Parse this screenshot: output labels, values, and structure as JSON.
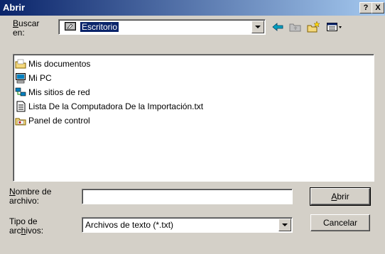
{
  "window": {
    "title": "Abrir",
    "help": "?",
    "close": "X"
  },
  "look_in": {
    "label_accel": "B",
    "label_rest": "uscar",
    "label_line2": "en:",
    "value": "Escritorio"
  },
  "toolbar": {
    "icons": [
      "back-arrow-icon",
      "up-folder-icon",
      "new-folder-icon",
      "view-menu-icon"
    ]
  },
  "files": [
    {
      "name": "Mis documentos",
      "icon": "my-documents-icon"
    },
    {
      "name": "Mi PC",
      "icon": "my-computer-icon"
    },
    {
      "name": "Mis sitios de red",
      "icon": "network-places-icon"
    },
    {
      "name": "Lista De la Computadora De la Importación.txt",
      "icon": "text-file-icon"
    },
    {
      "name": "Panel de control",
      "icon": "control-panel-icon"
    }
  ],
  "filename": {
    "label_accel": "N",
    "label_rest": "ombre de",
    "label_line2": "archivo:",
    "value": ""
  },
  "filetype": {
    "label_line1": "Tipo de",
    "label_pre": "arc",
    "label_accel": "h",
    "label_post": "ivos:",
    "value": "Archivos de texto (*.txt)"
  },
  "buttons": {
    "open_accel": "A",
    "open_rest": "brir",
    "cancel": "Cancelar"
  },
  "colors": {
    "face": "#d4d0c8",
    "title_start": "#0a246a",
    "title_end": "#a6caf0",
    "selection": "#0a246a"
  }
}
